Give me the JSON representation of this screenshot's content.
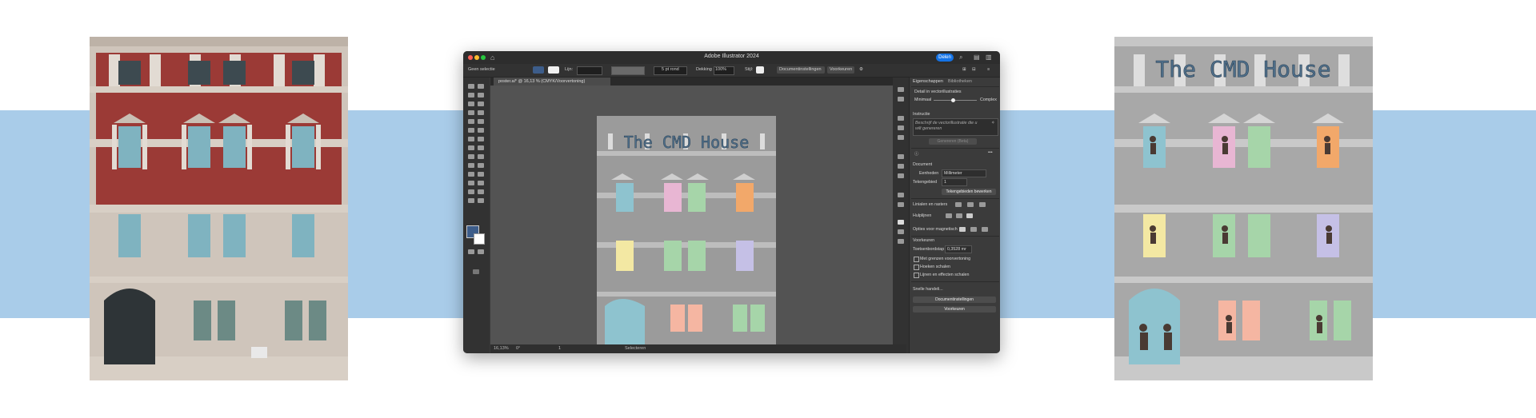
{
  "app": {
    "title": "Adobe Illustrator 2024",
    "share_label": "Delen"
  },
  "control_bar": {
    "selection": "Geen selectie",
    "stroke_label": "Lijn:",
    "brush": "5 pt rond",
    "opacity_label": "Dekking",
    "opacity_value": "100%",
    "style_label": "Stijl:",
    "doc_settings_button": "Documentinstellingen",
    "prefs_button": "Voorkeuren"
  },
  "document": {
    "tab_label": "poster.ai* @ 16,13 % (CMYK/Voorvertoning)",
    "artwork_title": "The CMD House"
  },
  "status_bar": {
    "zoom": "16,13%",
    "rotation": "0°",
    "artboard_number": "1",
    "tool": "Selecteren"
  },
  "panel": {
    "tabs": [
      "Eigenschappen",
      "Bibliotheken"
    ],
    "vectorize_detail": "Detail in vectorillustraties",
    "detail_min": "Minimaal",
    "detail_max": "Complex",
    "instruction_heading": "Instructie",
    "prompt_placeholder": "Beschrijf de vectorillustratie die u wilt genereren",
    "generate_button": "Genereren (Beta)",
    "document_heading": "Document",
    "units_label": "Eenheden",
    "units_value": "Millimeter",
    "artboard_label": "Tekengebied",
    "artboard_value": "1",
    "edit_artboards_button": "Tekengebieden bewerken",
    "rulers_heading": "Linialen en rasters",
    "guides_heading": "Hulplijnen",
    "snap_heading": "Opties voor magnetisch",
    "prefs_heading": "Voorkeuren",
    "keyboard_increment_label": "Toetsenbordstap",
    "keyboard_increment_value": "0,3528 mr",
    "check1": "Met grenzen voorvertoning",
    "check2": "Hoeken schalen",
    "check3": "Lijnen en effecten schalen",
    "quick_actions": "Snelle handeli...",
    "doc_settings_button": "Documentinstellingen",
    "prefs_button": "Voorkeuren"
  },
  "colors": {
    "brick": "#9b3a36",
    "sky_band": "#a9cce9",
    "window_glass_blue": "#8ec3cf",
    "window_pink": "#e8b6d3",
    "window_green": "#a6d5a9",
    "window_orange": "#f2a86a",
    "window_yellow": "#f3e8a3",
    "window_lavender": "#c5c0e6",
    "window_peach": "#f5b6a2",
    "title_text": "#4f6f8a",
    "accent_blue": "#1473e6"
  }
}
